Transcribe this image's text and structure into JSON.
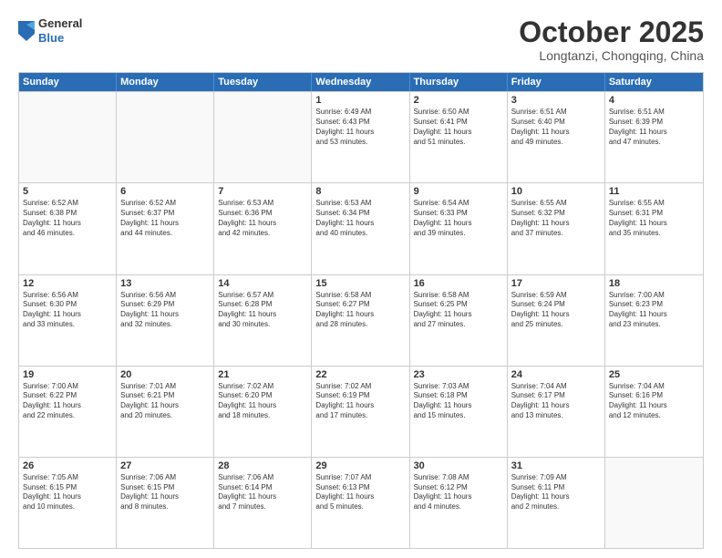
{
  "header": {
    "logo": {
      "general": "General",
      "blue": "Blue"
    },
    "title": "October 2025",
    "location": "Longtanzi, Chongqing, China"
  },
  "weekdays": [
    "Sunday",
    "Monday",
    "Tuesday",
    "Wednesday",
    "Thursday",
    "Friday",
    "Saturday"
  ],
  "weeks": [
    [
      {
        "day": "",
        "info": ""
      },
      {
        "day": "",
        "info": ""
      },
      {
        "day": "",
        "info": ""
      },
      {
        "day": "1",
        "info": "Sunrise: 6:49 AM\nSunset: 6:43 PM\nDaylight: 11 hours\nand 53 minutes."
      },
      {
        "day": "2",
        "info": "Sunrise: 6:50 AM\nSunset: 6:41 PM\nDaylight: 11 hours\nand 51 minutes."
      },
      {
        "day": "3",
        "info": "Sunrise: 6:51 AM\nSunset: 6:40 PM\nDaylight: 11 hours\nand 49 minutes."
      },
      {
        "day": "4",
        "info": "Sunrise: 6:51 AM\nSunset: 6:39 PM\nDaylight: 11 hours\nand 47 minutes."
      }
    ],
    [
      {
        "day": "5",
        "info": "Sunrise: 6:52 AM\nSunset: 6:38 PM\nDaylight: 11 hours\nand 46 minutes."
      },
      {
        "day": "6",
        "info": "Sunrise: 6:52 AM\nSunset: 6:37 PM\nDaylight: 11 hours\nand 44 minutes."
      },
      {
        "day": "7",
        "info": "Sunrise: 6:53 AM\nSunset: 6:36 PM\nDaylight: 11 hours\nand 42 minutes."
      },
      {
        "day": "8",
        "info": "Sunrise: 6:53 AM\nSunset: 6:34 PM\nDaylight: 11 hours\nand 40 minutes."
      },
      {
        "day": "9",
        "info": "Sunrise: 6:54 AM\nSunset: 6:33 PM\nDaylight: 11 hours\nand 39 minutes."
      },
      {
        "day": "10",
        "info": "Sunrise: 6:55 AM\nSunset: 6:32 PM\nDaylight: 11 hours\nand 37 minutes."
      },
      {
        "day": "11",
        "info": "Sunrise: 6:55 AM\nSunset: 6:31 PM\nDaylight: 11 hours\nand 35 minutes."
      }
    ],
    [
      {
        "day": "12",
        "info": "Sunrise: 6:56 AM\nSunset: 6:30 PM\nDaylight: 11 hours\nand 33 minutes."
      },
      {
        "day": "13",
        "info": "Sunrise: 6:56 AM\nSunset: 6:29 PM\nDaylight: 11 hours\nand 32 minutes."
      },
      {
        "day": "14",
        "info": "Sunrise: 6:57 AM\nSunset: 6:28 PM\nDaylight: 11 hours\nand 30 minutes."
      },
      {
        "day": "15",
        "info": "Sunrise: 6:58 AM\nSunset: 6:27 PM\nDaylight: 11 hours\nand 28 minutes."
      },
      {
        "day": "16",
        "info": "Sunrise: 6:58 AM\nSunset: 6:25 PM\nDaylight: 11 hours\nand 27 minutes."
      },
      {
        "day": "17",
        "info": "Sunrise: 6:59 AM\nSunset: 6:24 PM\nDaylight: 11 hours\nand 25 minutes."
      },
      {
        "day": "18",
        "info": "Sunrise: 7:00 AM\nSunset: 6:23 PM\nDaylight: 11 hours\nand 23 minutes."
      }
    ],
    [
      {
        "day": "19",
        "info": "Sunrise: 7:00 AM\nSunset: 6:22 PM\nDaylight: 11 hours\nand 22 minutes."
      },
      {
        "day": "20",
        "info": "Sunrise: 7:01 AM\nSunset: 6:21 PM\nDaylight: 11 hours\nand 20 minutes."
      },
      {
        "day": "21",
        "info": "Sunrise: 7:02 AM\nSunset: 6:20 PM\nDaylight: 11 hours\nand 18 minutes."
      },
      {
        "day": "22",
        "info": "Sunrise: 7:02 AM\nSunset: 6:19 PM\nDaylight: 11 hours\nand 17 minutes."
      },
      {
        "day": "23",
        "info": "Sunrise: 7:03 AM\nSunset: 6:18 PM\nDaylight: 11 hours\nand 15 minutes."
      },
      {
        "day": "24",
        "info": "Sunrise: 7:04 AM\nSunset: 6:17 PM\nDaylight: 11 hours\nand 13 minutes."
      },
      {
        "day": "25",
        "info": "Sunrise: 7:04 AM\nSunset: 6:16 PM\nDaylight: 11 hours\nand 12 minutes."
      }
    ],
    [
      {
        "day": "26",
        "info": "Sunrise: 7:05 AM\nSunset: 6:15 PM\nDaylight: 11 hours\nand 10 minutes."
      },
      {
        "day": "27",
        "info": "Sunrise: 7:06 AM\nSunset: 6:15 PM\nDaylight: 11 hours\nand 8 minutes."
      },
      {
        "day": "28",
        "info": "Sunrise: 7:06 AM\nSunset: 6:14 PM\nDaylight: 11 hours\nand 7 minutes."
      },
      {
        "day": "29",
        "info": "Sunrise: 7:07 AM\nSunset: 6:13 PM\nDaylight: 11 hours\nand 5 minutes."
      },
      {
        "day": "30",
        "info": "Sunrise: 7:08 AM\nSunset: 6:12 PM\nDaylight: 11 hours\nand 4 minutes."
      },
      {
        "day": "31",
        "info": "Sunrise: 7:09 AM\nSunset: 6:11 PM\nDaylight: 11 hours\nand 2 minutes."
      },
      {
        "day": "",
        "info": ""
      }
    ]
  ]
}
